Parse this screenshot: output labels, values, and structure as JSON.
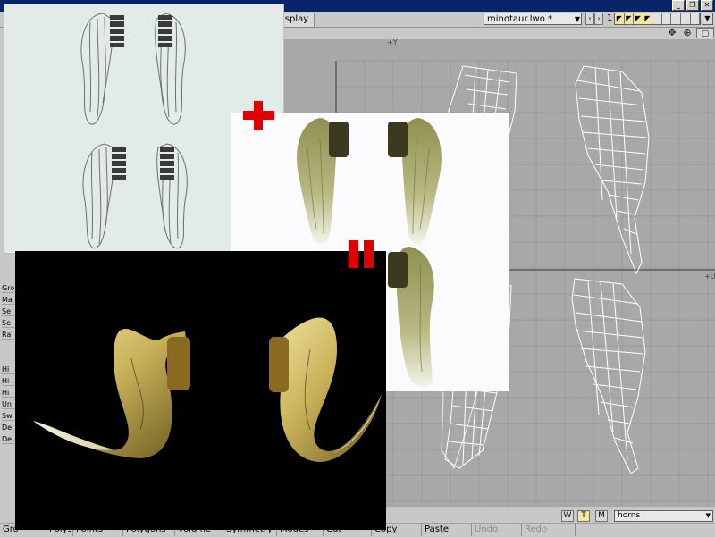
{
  "window": {
    "minimize_label": "_",
    "restore_label": "❐",
    "close_label": "✕"
  },
  "toolbar": {
    "display_tab_label": "isplay",
    "object_selector_value": "minotaur.lwo *",
    "prev_label": "‹",
    "next_label": "›",
    "layer_number": "1"
  },
  "viewport": {
    "view_label": "+Y",
    "axis_label_right": "+U"
  },
  "left_panel": {
    "items": [
      "Gro",
      "Ma",
      "Se",
      "Se",
      "Ra",
      "Hi",
      "Hi",
      "Hi",
      "Un",
      "Sw",
      "De",
      "De"
    ]
  },
  "bottom_bar": {
    "w_label": "W",
    "t_label": "T",
    "m_label": "M",
    "surface_selector_value": "horns"
  },
  "command_bar": {
    "items": [
      {
        "label": "Gro",
        "disabled": false
      },
      {
        "label": "Polys",
        "disabled": false
      },
      {
        "label": "Points",
        "disabled": false
      },
      {
        "label": "Polygons",
        "disabled": false
      },
      {
        "label": "Volume",
        "disabled": false
      },
      {
        "label": "Symmetry",
        "disabled": false
      },
      {
        "label": "Modes",
        "disabled": false
      },
      {
        "label": "Cut",
        "disabled": false
      },
      {
        "label": "Copy",
        "disabled": false
      },
      {
        "label": "Paste",
        "disabled": false
      },
      {
        "label": "Undo",
        "disabled": true
      },
      {
        "label": "Redo",
        "disabled": true
      }
    ]
  },
  "overlay": {
    "plus_color": "#e00000",
    "equals_color": "#e00000"
  },
  "colors": {
    "viewport_bg": "#a8a8a8",
    "wireframe": "#ffffff",
    "horn_gold": "#c9b25a",
    "texture_green": "#a7a86a"
  }
}
